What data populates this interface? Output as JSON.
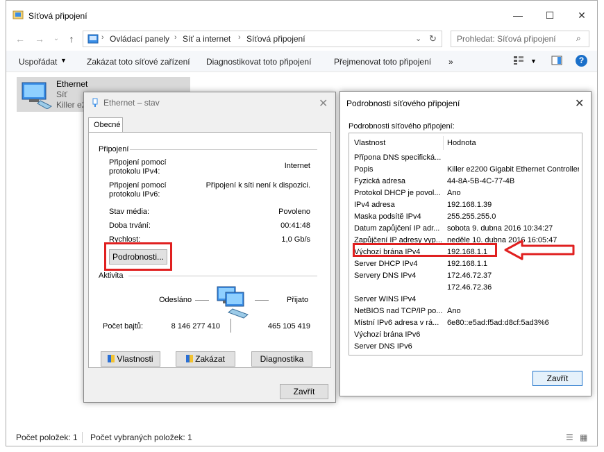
{
  "window": {
    "title": "Síťová připojení"
  },
  "address": {
    "crumbs": [
      "Ovládací panely",
      "Síť a internet",
      "Síťová připojení"
    ],
    "search_placeholder": "Prohledat: Síťová připojení"
  },
  "toolbar": {
    "organize": "Uspořádat",
    "disable": "Zakázat toto síťové zařízení",
    "diagnose": "Diagnostikovat toto připojení",
    "rename": "Přejmenovat toto připojení",
    "more": "»"
  },
  "ethernet_item": {
    "name": "Ethernet",
    "line2": "Síť",
    "line3": "Killer e2"
  },
  "statusbar": {
    "items_count": "Počet položek: 1",
    "selected_count": "Počet vybraných položek: 1"
  },
  "status_dialog": {
    "title": "Ethernet – stav",
    "tab": "Obecné",
    "group_connection": "Připojení",
    "ipv4_label": "Připojení pomocí protokolu IPv4:",
    "ipv4_value": "Internet",
    "ipv6_label": "Připojení pomocí protokolu IPv6:",
    "ipv6_value": "Připojení k síti není k dispozici.",
    "media_label": "Stav média:",
    "media_value": "Povoleno",
    "duration_label": "Doba trvání:",
    "duration_value": "00:41:48",
    "speed_label": "Rychlost:",
    "speed_value": "1,0 Gb/s",
    "details_button": "Podrobnosti...",
    "group_activity": "Aktivita",
    "sent_label": "Odesláno",
    "received_label": "Přijato",
    "bytes_label": "Počet bajtů:",
    "bytes_sent": "8 146 277 410",
    "bytes_received": "465 105 419",
    "properties_button": "Vlastnosti",
    "disable_button": "Zakázat",
    "diagnose_button": "Diagnostika",
    "close_button": "Zavřít"
  },
  "details_dialog": {
    "title": "Podrobnosti síťového připojení",
    "subtitle": "Podrobnosti síťového připojení:",
    "col_property": "Vlastnost",
    "col_value": "Hodnota",
    "rows": [
      [
        "Přípona DNS specifická...",
        ""
      ],
      [
        "Popis",
        "Killer e2200 Gigabit Ethernet Controller"
      ],
      [
        "Fyzická adresa",
        "44-8A-5B-4C-77-4B"
      ],
      [
        "Protokol DHCP je povol...",
        "Ano"
      ],
      [
        "IPv4 adresa",
        "192.168.1.39"
      ],
      [
        "Maska podsítě IPv4",
        "255.255.255.0"
      ],
      [
        "Datum zapůjčení IP adr...",
        "sobota 9. dubna 2016 10:34:27"
      ],
      [
        "Zapůjčení IP adresy vyp...",
        "neděle 10. dubna 2016 16:05:47"
      ],
      [
        "Výchozí brána IPv4",
        "192.168.1.1"
      ],
      [
        "Server DHCP IPv4",
        "192.168.1.1"
      ],
      [
        "Servery DNS IPv4",
        "172.46.72.37"
      ],
      [
        "",
        "172.46.72.36"
      ],
      [
        "Server WINS IPv4",
        ""
      ],
      [
        "NetBIOS nad TCP/IP po...",
        "Ano"
      ],
      [
        "Místní IPv6 adresa v rá...",
        "6e80::e5ad:f5ad:d8cf:5ad3%6"
      ],
      [
        "Výchozí brána IPv6",
        ""
      ],
      [
        "Server DNS IPv6",
        ""
      ]
    ],
    "close_button": "Zavřít"
  },
  "colors": {
    "highlight_red": "#e02020",
    "accent_blue": "#1a6fc9"
  }
}
